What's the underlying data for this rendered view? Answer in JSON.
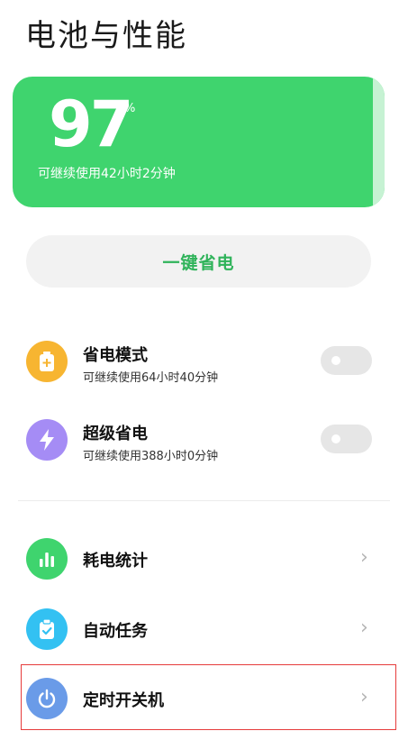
{
  "header": {
    "title": "电池与性能"
  },
  "battery": {
    "level": "97",
    "unit": "%",
    "remaining": "可继续使用42小时2分钟",
    "fill_fraction": 0.97
  },
  "quick_save": {
    "label": "一键省电"
  },
  "modes": [
    {
      "title": "省电模式",
      "subtitle": "可继续使用64小时40分钟",
      "icon": "battery-plus-icon",
      "icon_color": "#f7b531",
      "enabled": false
    },
    {
      "title": "超级省电",
      "subtitle": "可继续使用388小时0分钟",
      "icon": "lightning-icon",
      "icon_color": "#a58cf5",
      "enabled": false
    }
  ],
  "menu": [
    {
      "title": "耗电统计",
      "icon": "bar-chart-icon",
      "icon_color": "#3fd46e"
    },
    {
      "title": "自动任务",
      "icon": "clipboard-check-icon",
      "icon_color": "#33c1f2"
    },
    {
      "title": "定时开关机",
      "icon": "power-icon",
      "icon_color": "#6a9be8"
    }
  ],
  "colors": {
    "battery_card": "#3fd46e",
    "accent_text": "#2fb35a",
    "highlight_border": "#e63b3b"
  }
}
